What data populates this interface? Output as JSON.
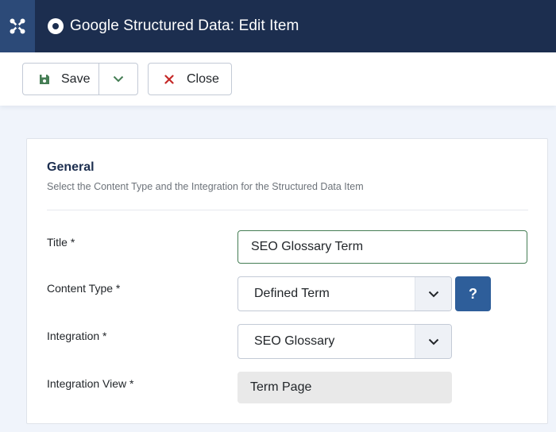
{
  "header": {
    "title": "Google Structured Data: Edit Item",
    "logo_icon": "joomla-logo-icon",
    "title_icon": "radio-dot-icon",
    "colors": {
      "header_bg": "#1c2e4f",
      "logo_bg": "#2c4a78"
    }
  },
  "toolbar": {
    "save_label": "Save",
    "save_icon": "floppy-disk-icon",
    "save_icon_color": "#457d54",
    "dropdown_icon": "chevron-down-icon",
    "close_label": "Close",
    "close_icon": "x-icon",
    "close_icon_color": "#c52827"
  },
  "card": {
    "title": "General",
    "description": "Select the Content Type and the Integration for the Structured Data Item"
  },
  "form": {
    "title": {
      "label": "Title *",
      "value": "SEO Glossary Term"
    },
    "content_type": {
      "label": "Content Type *",
      "value": "Defined Term",
      "help_label": "?"
    },
    "integration": {
      "label": "Integration *",
      "value": "SEO Glossary"
    },
    "integration_view": {
      "label": "Integration View *",
      "value": "Term Page"
    }
  }
}
